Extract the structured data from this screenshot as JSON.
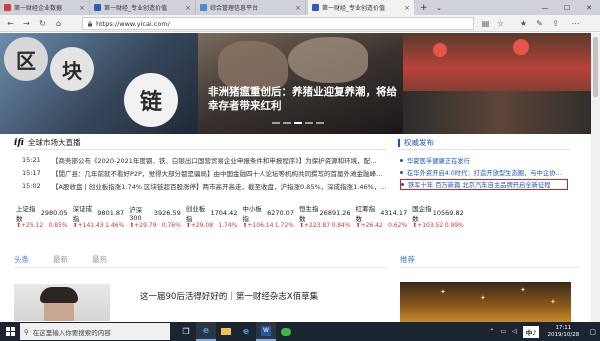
{
  "browser": {
    "tabs": [
      {
        "label": "第一财经企业数据",
        "active": false,
        "favicon_color": "#d73b3b"
      },
      {
        "label": "第一财经_专业创造价值",
        "active": false,
        "favicon_color": "#2d5fb6"
      },
      {
        "label": "综合管理信息平台",
        "active": false,
        "favicon_color": "#4a8bd6"
      },
      {
        "label": "第一财经_专业创造价值",
        "active": true,
        "favicon_color": "#2d5fb6"
      }
    ],
    "url": "https://www.yicai.com/"
  },
  "hero": {
    "title": "非洲猪瘟重创后：养猪业迎复养潮，将给幸存者带来红利",
    "coin_chars": [
      "区",
      "块",
      "链"
    ]
  },
  "market": {
    "logo": "ifi",
    "title": "全球市场大直播",
    "items": [
      {
        "time": "15:21",
        "text": "【商务部公布《2020-2021年度钢、铁、白银出口国营贸易企业申报条件和申报程序》】为保护资源和环境，配…"
      },
      {
        "time": "15:17",
        "text": "【閒广县：几年前就不看好P2P，觉得大部分都是骗局】由中国金融四十人论坛等机构共同撰写的首届外滩金融峰…"
      },
      {
        "time": "15:02",
        "text": "【A股收盘 | 创业板指涨1.74% 区块链超百股涨停】两市高开高走，截至收盘，沪指涨0.85%，深成指涨1.46%，…"
      }
    ]
  },
  "authority": {
    "title": "权威发布",
    "items": [
      {
        "text": "华夏医孚健康正在发行",
        "highlight": false
      },
      {
        "text": "在华外资开启4.0时代：打造开放型生态圈，与中企协同…",
        "highlight": false
      },
      {
        "text": "铁军十年 百万新篇 北京汽车自主品牌开启全新征程",
        "highlight": true
      }
    ]
  },
  "indices": [
    {
      "name": "上证指数",
      "value": "2980.05",
      "change": "+25.12",
      "pct": "0.85%"
    },
    {
      "name": "深证成指",
      "value": "9801.87",
      "change": "+141.43",
      "pct": "1.46%"
    },
    {
      "name": "沪深300",
      "value": "3926.59",
      "change": "+29.79",
      "pct": "0.76%"
    },
    {
      "name": "创业板指",
      "value": "1704.42",
      "change": "+29.08",
      "pct": "1.74%"
    },
    {
      "name": "中小板指",
      "value": "6270.07",
      "change": "+106.14",
      "pct": "1.72%"
    },
    {
      "name": "恒生指数",
      "value": "26891.26",
      "change": "+223.87",
      "pct": "0.84%"
    },
    {
      "name": "红筹指数",
      "value": "4314.17",
      "change": "+26.42",
      "pct": "0.62%"
    },
    {
      "name": "国企指数",
      "value": "10569.82",
      "change": "+103.52",
      "pct": "0.99%"
    }
  ],
  "feed": {
    "tabs": [
      "头条",
      "最新",
      "最热"
    ],
    "active_tab": 0,
    "recommend": "推荐",
    "article_title": "这一届90后活得好好的｜第一财经杂志X佰草集"
  },
  "taskbar": {
    "search_placeholder": "在这里输入你要搜索的内容",
    "ime": "中♪",
    "time": "17:11",
    "date": "2019/10/28"
  },
  "colors": {
    "accent": "#1a56b8",
    "up": "#d43b2c",
    "highlight_border": "#d62020"
  }
}
